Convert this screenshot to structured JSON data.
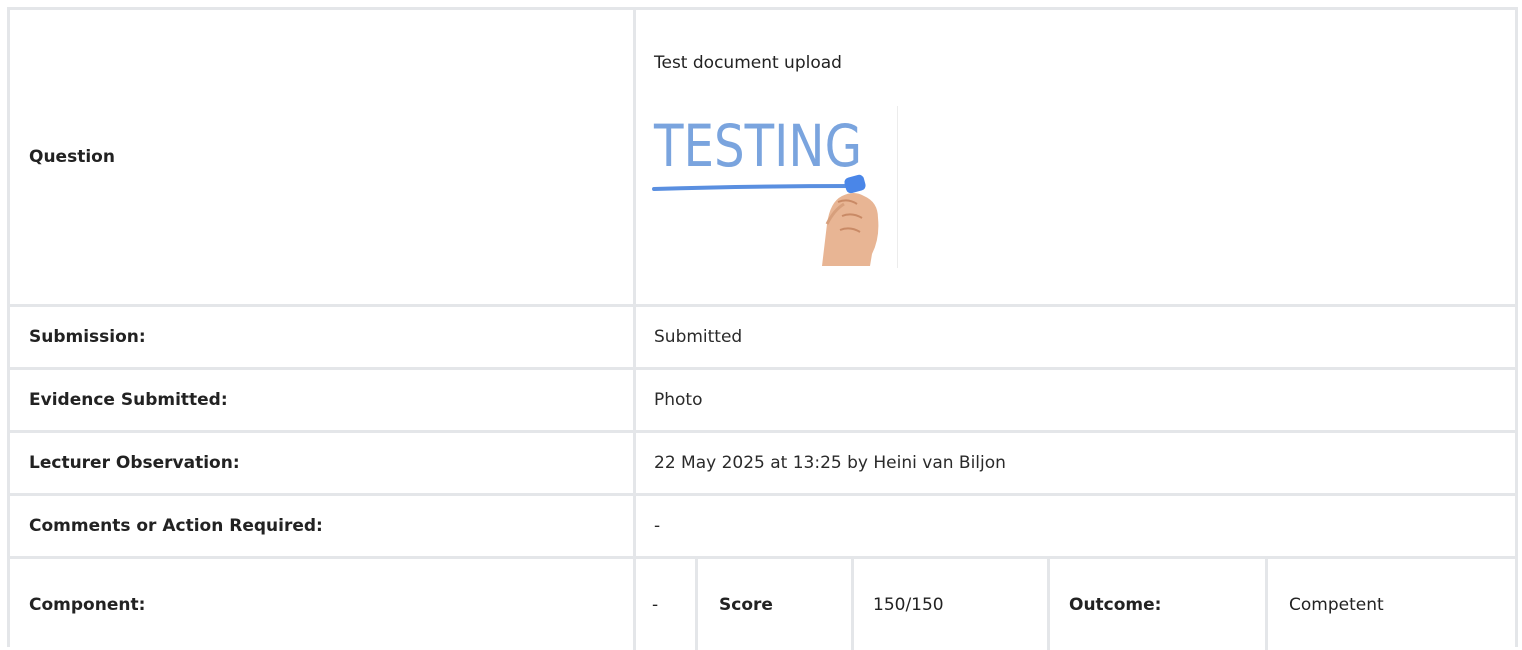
{
  "question": {
    "label": "Question",
    "text": "Test document upload",
    "image": {
      "caption": "TESTING",
      "icon": "testing-handwriting-image"
    }
  },
  "rows": [
    {
      "label": "Submission:",
      "value": "Submitted"
    },
    {
      "label": "Evidence Submitted:",
      "value": "Photo"
    },
    {
      "label": "Lecturer Observation:",
      "value": "22 May 2025 at 13:25 by Heini van Biljon"
    },
    {
      "label": "Comments or Action Required:",
      "value": "-"
    }
  ],
  "component": {
    "label": "Component:",
    "value": "-",
    "score_label": "Score",
    "score_value": "150/150",
    "outcome_label": "Outcome:",
    "outcome_value": "Competent"
  },
  "colors": {
    "border": "#e4e6e9",
    "testing_text": "#7aa4de",
    "underline": "#5a8fe0"
  }
}
